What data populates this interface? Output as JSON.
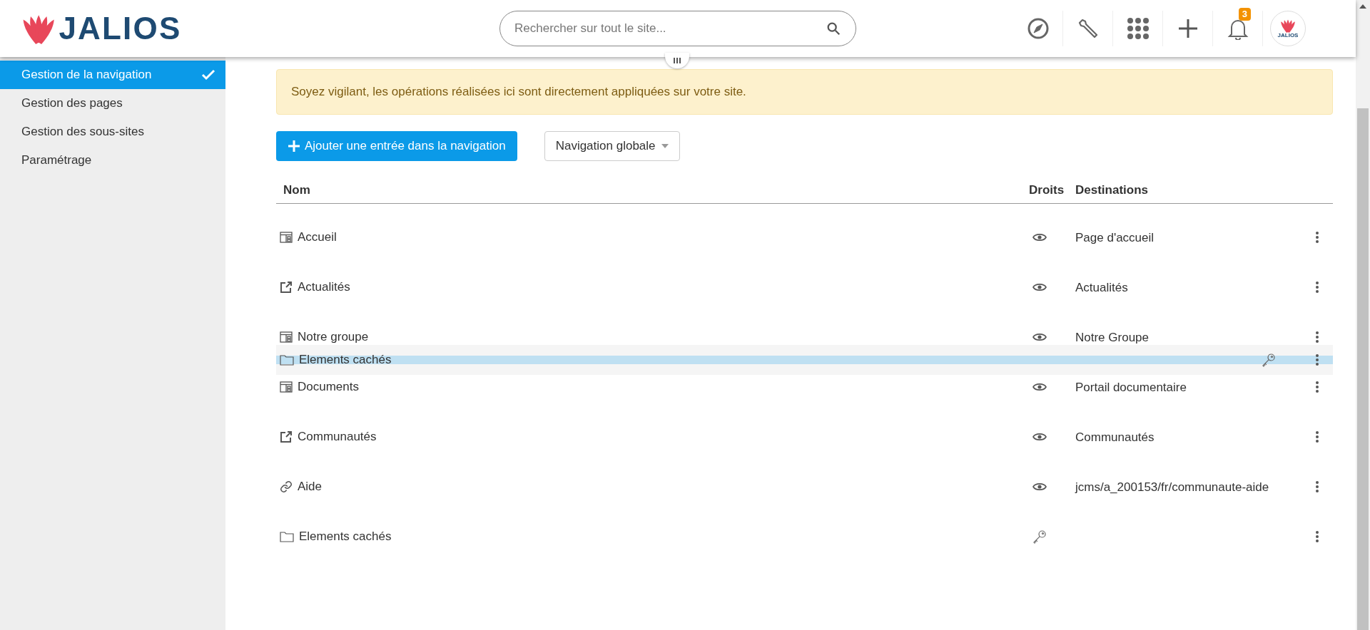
{
  "header": {
    "logo": "JALIOS",
    "search": {
      "placeholder": "Rechercher sur tout le site..."
    },
    "notifications": {
      "count": "3"
    },
    "avatar": {
      "text": "JALIOS"
    }
  },
  "sidebar": {
    "items": [
      {
        "label": "Gestion de la navigation",
        "selected": true
      },
      {
        "label": "Gestion des pages",
        "selected": false
      },
      {
        "label": "Gestion des sous-sites",
        "selected": false
      },
      {
        "label": "Paramétrage",
        "selected": false
      }
    ]
  },
  "alert": "Soyez vigilant, les opérations réalisées ici sont directement appliquées sur votre site.",
  "toolbar": {
    "add_button": "Ajouter une entrée dans la navigation",
    "dropdown": "Navigation globale"
  },
  "table": {
    "columns": [
      "Nom",
      "Droits",
      "Destinations"
    ],
    "rows": [
      {
        "kind": "page",
        "name": "Accueil",
        "restricted": false,
        "destination": "Page d'accueil"
      },
      {
        "kind": "external",
        "name": "Actualités",
        "restricted": false,
        "destination": "Actualités"
      },
      {
        "kind": "page",
        "name": "Notre groupe",
        "restricted": false,
        "destination": "Notre Groupe"
      },
      {
        "kind": "page",
        "name": "Documents",
        "restricted": false,
        "destination": "Portail documentaire"
      },
      {
        "kind": "external",
        "name": "Communautés",
        "restricted": false,
        "destination": "Communautés"
      },
      {
        "kind": "link",
        "name": "Aide",
        "restricted": false,
        "destination": "jcms/a_200153/fr/communaute-aide"
      },
      {
        "kind": "folder",
        "name": "Elements cachés",
        "restricted": true
      }
    ],
    "dragged_row": {
      "kind": "folder",
      "name": "Elements cachés",
      "restricted": true
    }
  }
}
